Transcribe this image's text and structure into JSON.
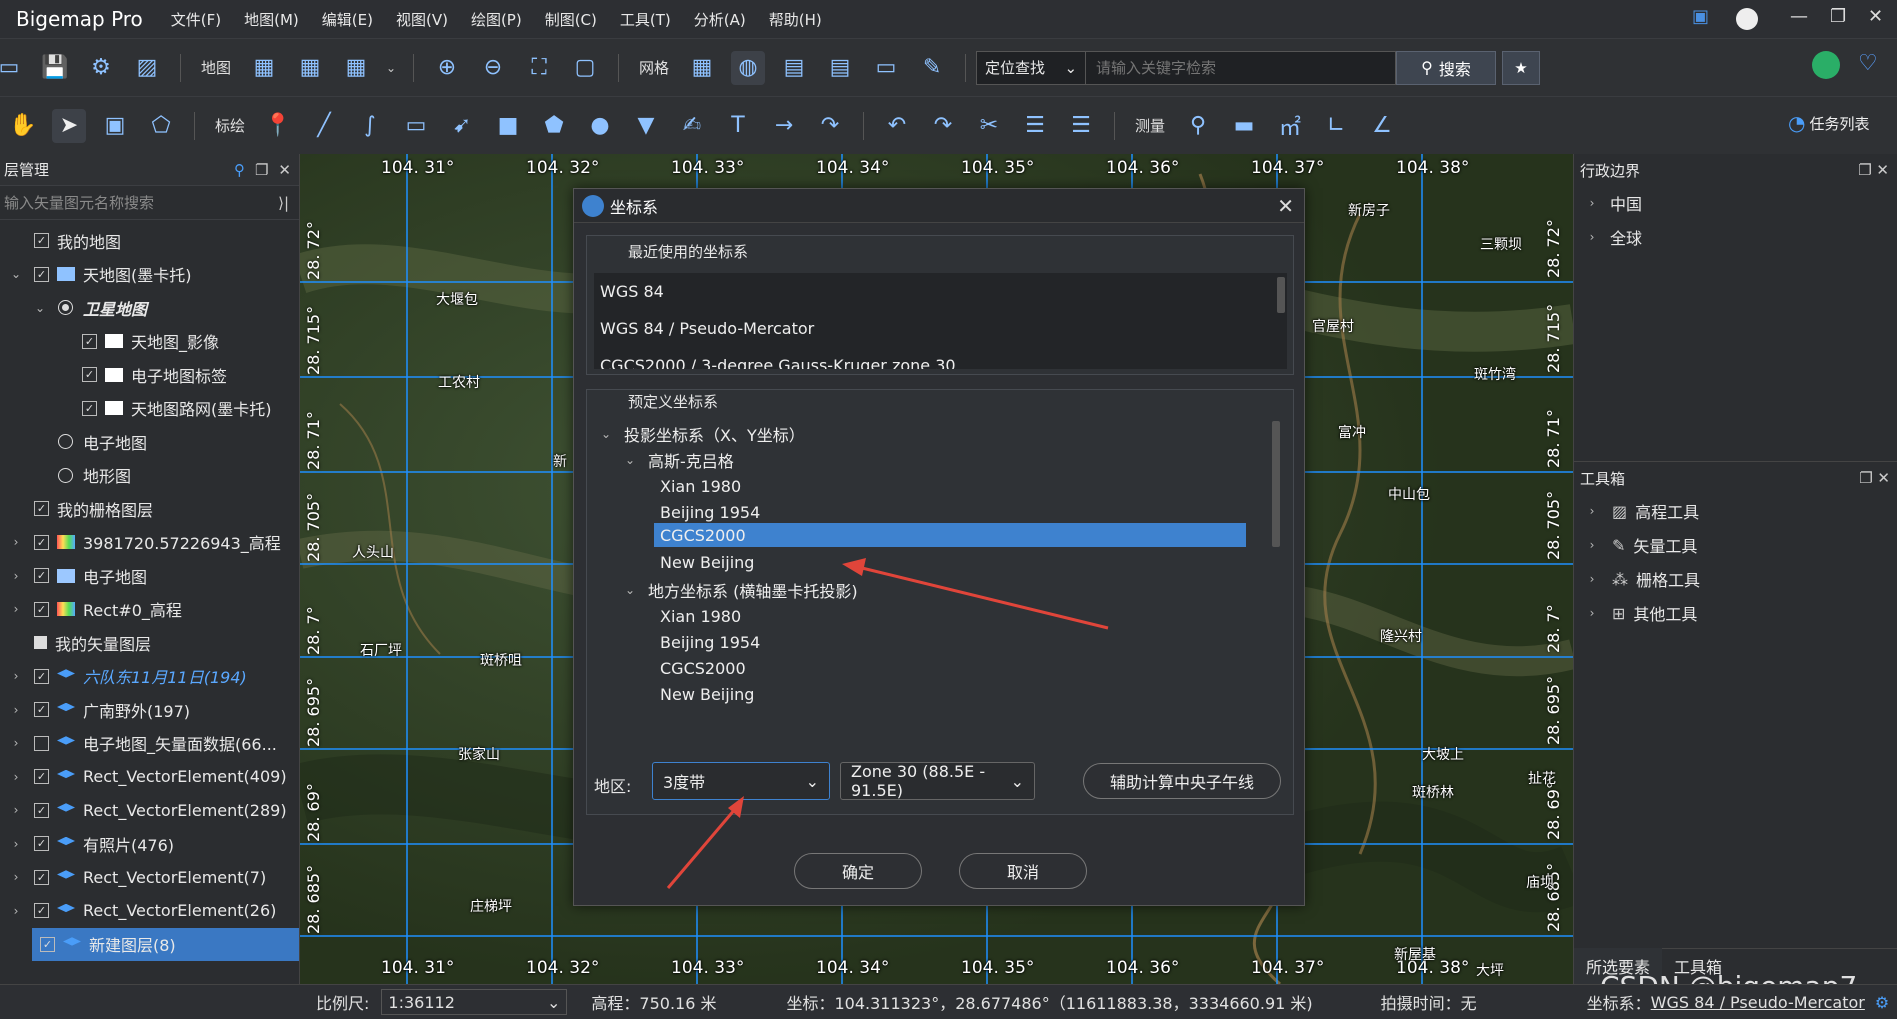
{
  "app": {
    "title": "Bigemap Pro"
  },
  "menu": [
    "文件(F)",
    "地图(M)",
    "编辑(E)",
    "视图(V)",
    "绘图(P)",
    "制图(C)",
    "工具(T)",
    "分析(A)",
    "帮助(H)"
  ],
  "toolbar1": {
    "map_label": "地图",
    "grid_label": "网格",
    "locate_combo": "定位查找",
    "search_placeholder": "请输入关键字检索",
    "search_button": "搜索"
  },
  "toolbar2": {
    "annotate_label": "标绘",
    "measure_label": "测量",
    "tasklist_label": "任务列表"
  },
  "left_panel": {
    "title": "层管理",
    "search_placeholder": "输入矢量图元名称搜索",
    "rows": [
      {
        "label": "我的地图"
      },
      {
        "label": "天地图(墨卡托)"
      },
      {
        "label": "卫星地图"
      },
      {
        "label": "天地图_影像"
      },
      {
        "label": "电子地图标签"
      },
      {
        "label": "天地图路网(墨卡托)"
      },
      {
        "label": "电子地图"
      },
      {
        "label": "地形图"
      },
      {
        "label": "我的栅格图层"
      },
      {
        "label": "3981720.57226943_高程"
      },
      {
        "label": "电子地图"
      },
      {
        "label": "Rect#0_高程"
      },
      {
        "label": "我的矢量图层"
      },
      {
        "label": "六队东11月11日(194)"
      },
      {
        "label": "广南野外(197)"
      },
      {
        "label": "电子地图_矢量面数据(66..."
      },
      {
        "label": "Rect_VectorElement(409)"
      },
      {
        "label": "Rect_VectorElement(289)"
      },
      {
        "label": "有照片(476)"
      },
      {
        "label": "Rect_VectorElement(7)"
      },
      {
        "label": "Rect_VectorElement(26)"
      },
      {
        "label": "新建图层(8)"
      }
    ]
  },
  "map": {
    "lon_labels": [
      "104. 31°",
      "104. 32°",
      "104. 33°",
      "104. 34°",
      "104. 35°",
      "104. 36°",
      "104. 37°",
      "104. 38°"
    ],
    "lat_labels_left": [
      "28. 72°",
      "28. 715°",
      "28. 71°",
      "28. 705°",
      "28. 7°",
      "28. 695°",
      "28. 69°",
      "28. 685°"
    ],
    "lat_labels_right": [
      "28. 72°",
      "28. 715°",
      "28. 71°",
      "28. 705°",
      "28. 7°",
      "28. 695°",
      "28. 69°",
      "28. 685°"
    ],
    "places": [
      "大堰包",
      "工农村",
      "人头山",
      "石厂坪",
      "斑桥咀",
      "张家山",
      "庄梯坪",
      "新房子",
      "三颗坝",
      "官屋村",
      "斑竹湾",
      "富冲",
      "中山包",
      "隆兴村",
      "大坡上",
      "斑桥林",
      "扯花",
      "庙坝",
      "新屋基",
      "大坪",
      "新"
    ]
  },
  "dialog": {
    "title": "坐标系",
    "recent_title": "最近使用的坐标系",
    "recent_items": [
      "WGS 84",
      "WGS 84 / Pseudo-Mercator",
      "CGCS2000 / 3-degree Gauss-Kruger zone 30"
    ],
    "predefined_title": "预定义坐标系",
    "tree": {
      "projected": "投影坐标系（X、Y坐标）",
      "gauss": "高斯-克吕格",
      "gauss_items": [
        "Xian 1980",
        "Beijing 1954",
        "CGCS2000",
        "New Beijing"
      ],
      "local": "地方坐标系 (横轴墨卡托投影)",
      "local_items": [
        "Xian 1980",
        "Beijing 1954",
        "CGCS2000",
        "New Beijing"
      ]
    },
    "region_label": "地区:",
    "band_combo": "3度带",
    "zone_combo": "Zone 30 (88.5E - 91.5E)",
    "calc_button": "辅助计算中央子午线",
    "ok_button": "确定",
    "cancel_button": "取消"
  },
  "right_panel": {
    "admin_title": "行政边界",
    "admin_items": [
      "中国",
      "全球"
    ],
    "toolbox_title": "工具箱",
    "toolbox_items": [
      "高程工具",
      "矢量工具",
      "栅格工具",
      "其他工具"
    ],
    "tabs": [
      "所选要素",
      "工具箱"
    ],
    "watermark": "CSDN @bigemap7"
  },
  "status": {
    "scale_label": "比例尺:",
    "scale_value": "1:36112",
    "elevation": "高程：750.16 米",
    "coords": "坐标：104.311323°，28.677486°（11611883.38，3334660.91 米)",
    "capture_time": "拍摄时间：无",
    "crs_label": "坐标系：",
    "crs_value": "WGS 84 / Pseudo-Mercator"
  },
  "colors": {
    "accent": "#3e82cf",
    "selection": "#3a78c3",
    "arrow": "#e0453a",
    "grid": "#1e90ff"
  }
}
